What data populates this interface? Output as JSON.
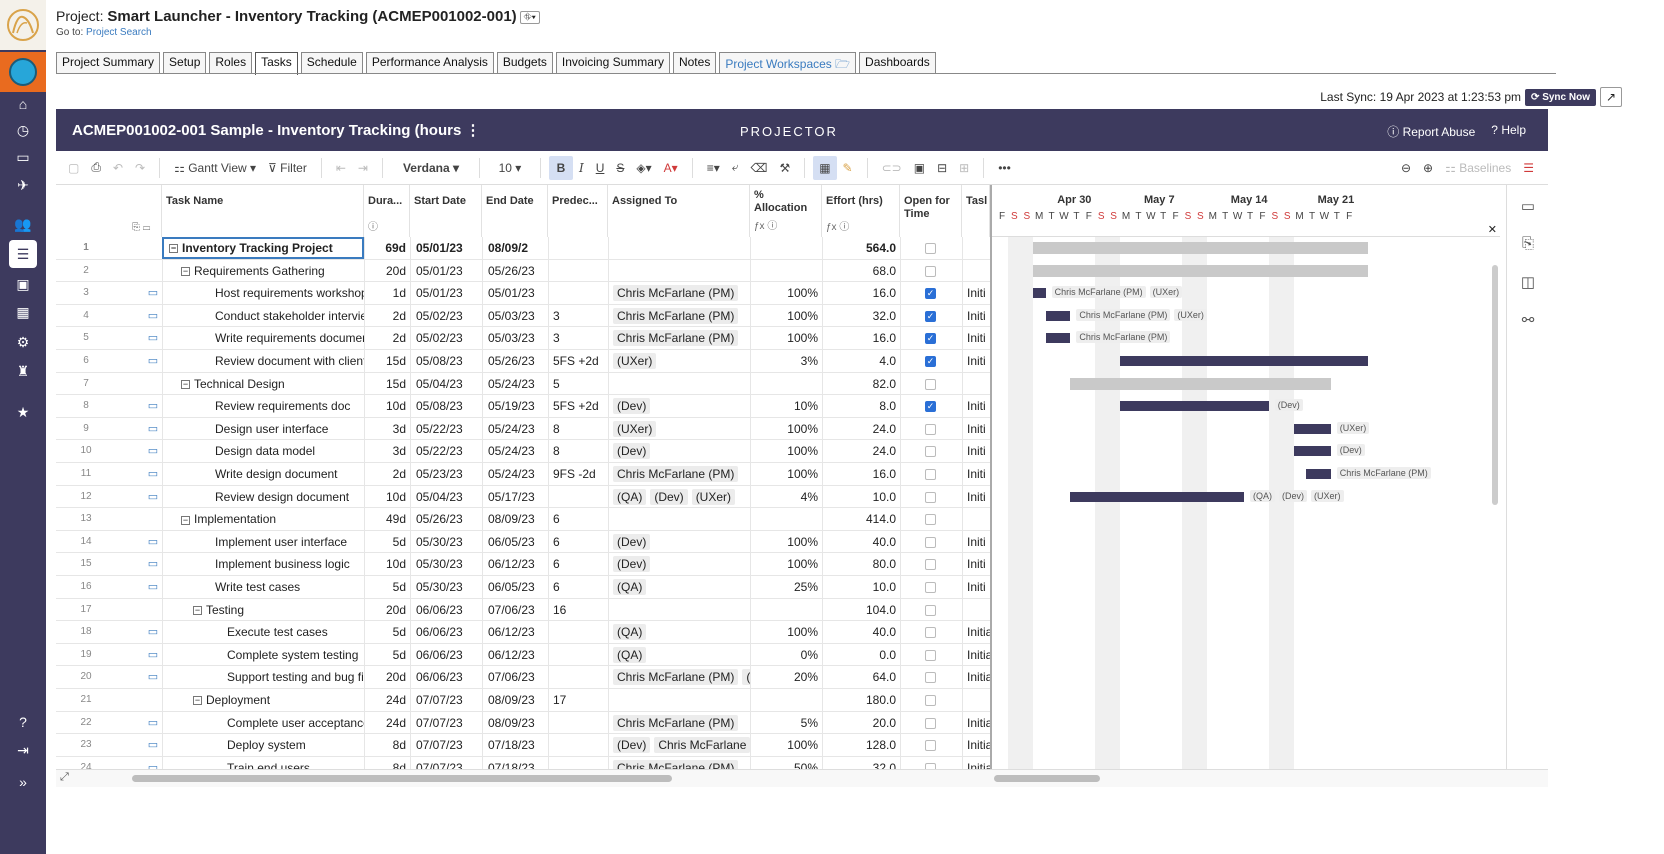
{
  "project": {
    "label": "Project:",
    "name": "Smart Launcher - Inventory Tracking (ACMEP001002-001)",
    "goto_label": "Go to:",
    "goto_link": "Project Search"
  },
  "tabs": [
    {
      "label": "Project Summary"
    },
    {
      "label": "Setup"
    },
    {
      "label": "Roles"
    },
    {
      "label": "Tasks",
      "active": true
    },
    {
      "label": "Schedule"
    },
    {
      "label": "Performance Analysis"
    },
    {
      "label": "Budgets"
    },
    {
      "label": "Invoicing Summary"
    },
    {
      "label": "Notes"
    },
    {
      "label": "Project Workspaces"
    },
    {
      "label": "Dashboards"
    }
  ],
  "sync": {
    "text": "Last Sync: 19 Apr 2023 at 1:23:53 pm",
    "button": "Sync Now"
  },
  "banner": {
    "title": "ACMEP001002-001 Sample - Inventory Tracking (hours",
    "brand": "PROJECTOR",
    "report_abuse": "Report Abuse",
    "help": "Help"
  },
  "toolbar": {
    "gantt_view": "Gantt View",
    "filter": "Filter",
    "font": "Verdana",
    "font_size": "10",
    "baselines": "Baselines"
  },
  "columns": {
    "task_name": "Task Name",
    "duration": "Dura...",
    "start": "Start Date",
    "end": "End Date",
    "pred": "Predec...",
    "assigned": "Assigned To",
    "alloc": "% Allocation",
    "effort": "Effort (hrs)",
    "open": "Open for Time",
    "task": "Tasl"
  },
  "rows": [
    {
      "n": "1",
      "name": "Inventory Tracking Project",
      "level": 0,
      "group": true,
      "dur": "69d",
      "sd": "05/01/23",
      "ed": "08/09/2",
      "pr": "",
      "as": [],
      "al": "",
      "ef": "564.0",
      "op": false,
      "ts": "",
      "cm": false
    },
    {
      "n": "2",
      "name": "Requirements Gathering",
      "level": 1,
      "group": true,
      "dur": "20d",
      "sd": "05/01/23",
      "ed": "05/26/23",
      "pr": "",
      "as": [],
      "al": "",
      "ef": "68.0",
      "op": false,
      "ts": "",
      "cm": false
    },
    {
      "n": "3",
      "name": "Host requirements workshop",
      "level": 2,
      "dur": "1d",
      "sd": "05/01/23",
      "ed": "05/01/23",
      "pr": "",
      "as": [
        "Chris McFarlane (PM)"
      ],
      "al": "100%",
      "ef": "16.0",
      "op": true,
      "ts": "Initi",
      "cm": true
    },
    {
      "n": "4",
      "name": "Conduct stakeholder interview",
      "level": 2,
      "dur": "2d",
      "sd": "05/02/23",
      "ed": "05/03/23",
      "pr": "3",
      "as": [
        "Chris McFarlane (PM)"
      ],
      "al": "100%",
      "ef": "32.0",
      "op": true,
      "ts": "Initi",
      "cm": true
    },
    {
      "n": "5",
      "name": "Write requirements document",
      "level": 2,
      "dur": "2d",
      "sd": "05/02/23",
      "ed": "05/03/23",
      "pr": "3",
      "as": [
        "Chris McFarlane (PM)"
      ],
      "al": "100%",
      "ef": "16.0",
      "op": true,
      "ts": "Initi",
      "cm": true
    },
    {
      "n": "6",
      "name": "Review document with client",
      "level": 2,
      "dur": "15d",
      "sd": "05/08/23",
      "ed": "05/26/23",
      "pr": "5FS +2d",
      "as": [
        "(UXer)"
      ],
      "al": "3%",
      "ef": "4.0",
      "op": true,
      "ts": "Initi",
      "cm": true
    },
    {
      "n": "7",
      "name": "Technical Design",
      "level": 1,
      "group": true,
      "dur": "15d",
      "sd": "05/04/23",
      "ed": "05/24/23",
      "pr": "5",
      "as": [],
      "al": "",
      "ef": "82.0",
      "op": false,
      "ts": "",
      "cm": false
    },
    {
      "n": "8",
      "name": "Review requirements doc",
      "level": 2,
      "dur": "10d",
      "sd": "05/08/23",
      "ed": "05/19/23",
      "pr": "5FS +2d",
      "as": [
        "(Dev)"
      ],
      "al": "10%",
      "ef": "8.0",
      "op": true,
      "ts": "Initi",
      "cm": true
    },
    {
      "n": "9",
      "name": "Design user interface",
      "level": 2,
      "dur": "3d",
      "sd": "05/22/23",
      "ed": "05/24/23",
      "pr": "8",
      "as": [
        "(UXer)"
      ],
      "al": "100%",
      "ef": "24.0",
      "op": false,
      "ts": "Initi",
      "cm": true
    },
    {
      "n": "10",
      "name": "Design data model",
      "level": 2,
      "dur": "3d",
      "sd": "05/22/23",
      "ed": "05/24/23",
      "pr": "8",
      "as": [
        "(Dev)"
      ],
      "al": "100%",
      "ef": "24.0",
      "op": false,
      "ts": "Initi",
      "cm": true
    },
    {
      "n": "11",
      "name": "Write design document",
      "level": 2,
      "dur": "2d",
      "sd": "05/23/23",
      "ed": "05/24/23",
      "pr": "9FS -2d",
      "as": [
        "Chris McFarlane (PM)"
      ],
      "al": "100%",
      "ef": "16.0",
      "op": false,
      "ts": "Initi",
      "cm": true
    },
    {
      "n": "12",
      "name": "Review design document",
      "level": 2,
      "dur": "10d",
      "sd": "05/04/23",
      "ed": "05/17/23",
      "pr": "",
      "as": [
        "(QA)",
        "(Dev)",
        "(UXer)"
      ],
      "al": "4%",
      "ef": "10.0",
      "op": false,
      "ts": "Initi",
      "cm": true
    },
    {
      "n": "13",
      "name": "Implementation",
      "level": 1,
      "group": true,
      "dur": "49d",
      "sd": "05/26/23",
      "ed": "08/09/23",
      "pr": "6",
      "as": [],
      "al": "",
      "ef": "414.0",
      "op": false,
      "ts": "",
      "cm": false
    },
    {
      "n": "14",
      "name": "Implement user interface",
      "level": 2,
      "dur": "5d",
      "sd": "05/30/23",
      "ed": "06/05/23",
      "pr": "6",
      "as": [
        "(Dev)"
      ],
      "al": "100%",
      "ef": "40.0",
      "op": false,
      "ts": "Initi",
      "cm": true
    },
    {
      "n": "15",
      "name": "Implement business logic",
      "level": 2,
      "dur": "10d",
      "sd": "05/30/23",
      "ed": "06/12/23",
      "pr": "6",
      "as": [
        "(Dev)"
      ],
      "al": "100%",
      "ef": "80.0",
      "op": false,
      "ts": "Initi",
      "cm": true
    },
    {
      "n": "16",
      "name": "Write test cases",
      "level": 2,
      "dur": "5d",
      "sd": "05/30/23",
      "ed": "06/05/23",
      "pr": "6",
      "as": [
        "(QA)"
      ],
      "al": "25%",
      "ef": "10.0",
      "op": false,
      "ts": "Initi",
      "cm": true
    },
    {
      "n": "17",
      "name": "Testing",
      "level": 2,
      "group": true,
      "dur": "20d",
      "sd": "06/06/23",
      "ed": "07/06/23",
      "pr": "16",
      "as": [],
      "al": "",
      "ef": "104.0",
      "op": false,
      "ts": "",
      "cm": false
    },
    {
      "n": "18",
      "name": "Execute test cases",
      "level": 3,
      "dur": "5d",
      "sd": "06/06/23",
      "ed": "06/12/23",
      "pr": "",
      "as": [
        "(QA)"
      ],
      "al": "100%",
      "ef": "40.0",
      "op": false,
      "ts": "Initia",
      "cm": true
    },
    {
      "n": "19",
      "name": "Complete system testing",
      "level": 3,
      "dur": "5d",
      "sd": "06/06/23",
      "ed": "06/12/23",
      "pr": "",
      "as": [
        "(QA)"
      ],
      "al": "0%",
      "ef": "0.0",
      "op": false,
      "ts": "Initia",
      "cm": true
    },
    {
      "n": "20",
      "name": "Support testing and bug fixing",
      "level": 3,
      "dur": "20d",
      "sd": "06/06/23",
      "ed": "07/06/23",
      "pr": "",
      "as": [
        "Chris McFarlane (PM)",
        "(L"
      ],
      "al": "20%",
      "ef": "64.0",
      "op": false,
      "ts": "Initia",
      "cm": true
    },
    {
      "n": "21",
      "name": "Deployment",
      "level": 2,
      "group": true,
      "dur": "24d",
      "sd": "07/07/23",
      "ed": "08/09/23",
      "pr": "17",
      "as": [],
      "al": "",
      "ef": "180.0",
      "op": false,
      "ts": "",
      "cm": false
    },
    {
      "n": "22",
      "name": "Complete user acceptance te",
      "level": 3,
      "dur": "24d",
      "sd": "07/07/23",
      "ed": "08/09/23",
      "pr": "",
      "as": [
        "Chris McFarlane (PM)"
      ],
      "al": "5%",
      "ef": "20.0",
      "op": false,
      "ts": "Initia",
      "cm": true
    },
    {
      "n": "23",
      "name": "Deploy system",
      "level": 3,
      "dur": "8d",
      "sd": "07/07/23",
      "ed": "07/18/23",
      "pr": "",
      "as": [
        "(Dev)",
        "Chris McFarlane"
      ],
      "al": "100%",
      "ef": "128.0",
      "op": false,
      "ts": "Initia",
      "cm": true
    },
    {
      "n": "24",
      "name": "Train end users",
      "level": 3,
      "dur": "8d",
      "sd": "07/07/23",
      "ed": "07/18/23",
      "pr": "",
      "as": [
        "Chris McFarlane (PM)"
      ],
      "al": "50%",
      "ef": "32.0",
      "op": false,
      "ts": "Initia",
      "cm": true
    }
  ],
  "gantt": {
    "weeks": [
      "Apr 30",
      "May 7",
      "May 14",
      "May 21"
    ],
    "days": [
      "F",
      "S",
      "S",
      "M",
      "T",
      "W",
      "T",
      "F",
      "S",
      "S",
      "M",
      "T",
      "W",
      "T",
      "F",
      "S",
      "S",
      "M",
      "T",
      "W",
      "T",
      "F",
      "S",
      "S",
      "M",
      "T",
      "W",
      "T",
      "F"
    ],
    "bars": [
      {
        "row": 0,
        "start": 3,
        "len": 27,
        "summary": true,
        "labels": []
      },
      {
        "row": 1,
        "start": 3,
        "len": 27,
        "summary": true,
        "labels": []
      },
      {
        "row": 2,
        "start": 3,
        "len": 1,
        "labels": [
          "Chris McFarlane (PM)",
          "(UXer)"
        ]
      },
      {
        "row": 3,
        "start": 4,
        "len": 2,
        "labels": [
          "Chris McFarlane (PM)",
          "(UXer)"
        ]
      },
      {
        "row": 4,
        "start": 4,
        "len": 2,
        "labels": [
          "Chris McFarlane (PM)"
        ]
      },
      {
        "row": 5,
        "start": 10,
        "len": 20,
        "labels": []
      },
      {
        "row": 6,
        "start": 6,
        "len": 21,
        "summary": true,
        "labels": []
      },
      {
        "row": 7,
        "start": 10,
        "len": 12,
        "labels": [
          "(Dev)"
        ]
      },
      {
        "row": 8,
        "start": 24,
        "len": 3,
        "labels": [
          "(UXer)"
        ]
      },
      {
        "row": 9,
        "start": 24,
        "len": 3,
        "labels": [
          "(Dev)"
        ]
      },
      {
        "row": 10,
        "start": 25,
        "len": 2,
        "labels": [
          "Chris McFarlane (PM)"
        ]
      },
      {
        "row": 11,
        "start": 6,
        "len": 14,
        "labels": [
          "(QA)",
          "(Dev)",
          "(UXer)"
        ]
      }
    ]
  }
}
